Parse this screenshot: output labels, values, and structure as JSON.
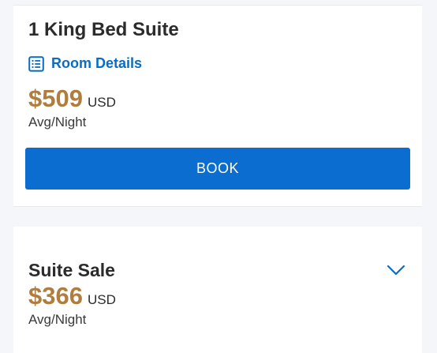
{
  "rooms": [
    {
      "title": "1 King Bed Suite",
      "details_label": "Room Details",
      "price": "$509",
      "currency": "USD",
      "per_night": "Avg/Night",
      "book_label": "BOOK"
    },
    {
      "title": "Suite Sale",
      "price": "$366",
      "currency": "USD",
      "per_night": "Avg/Night"
    }
  ],
  "icons": {
    "details": "list-document-icon",
    "expand": "chevron-down-icon"
  },
  "colors": {
    "accent_blue": "#0a6dcf",
    "link_blue": "#0a6dc2",
    "price_gold": "#b07d3e",
    "background": "#f4f6f9"
  }
}
